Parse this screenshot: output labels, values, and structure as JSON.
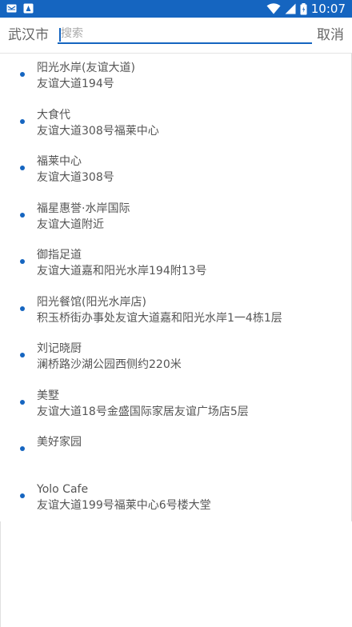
{
  "status_bar": {
    "time": "10:07",
    "left_icons": [
      "email-icon",
      "app-notification-icon"
    ],
    "right_icons": [
      "wifi-icon",
      "signal-icon",
      "battery-icon"
    ],
    "background_color": "#1565c0"
  },
  "search": {
    "city": "武汉市",
    "placeholder": "搜索",
    "value": "",
    "cancel_label": "取消",
    "accent_color": "#1565c0"
  },
  "results": [
    {
      "name": "阳光水岸(友谊大道)",
      "address": "友谊大道194号"
    },
    {
      "name": "大食代",
      "address": "友谊大道308号福莱中心"
    },
    {
      "name": "福莱中心",
      "address": "友谊大道308号"
    },
    {
      "name": "福星惠誉·水岸国际",
      "address": "友谊大道附近"
    },
    {
      "name": "御指足道",
      "address": "友谊大道嘉和阳光水岸194附13号"
    },
    {
      "name": "阳光餐馆(阳光水岸店)",
      "address": "积玉桥街办事处友谊大道嘉和阳光水岸1一4栋1层"
    },
    {
      "name": "刘记晓厨",
      "address": "澜桥路沙湖公园西侧约220米"
    },
    {
      "name": "美墅",
      "address": "友谊大道18号金盛国际家居友谊广场店5层"
    },
    {
      "name": "美好家园",
      "address": ""
    },
    {
      "name": "Yolo Cafe",
      "address": "友谊大道199号福莱中心6号楼大堂"
    }
  ]
}
